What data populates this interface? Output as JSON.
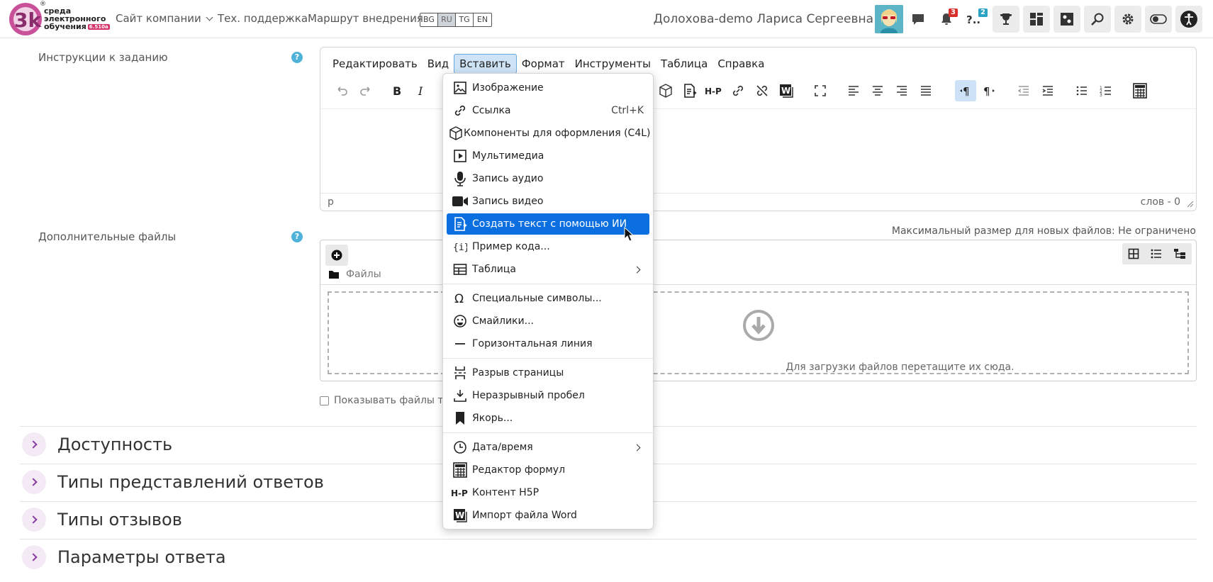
{
  "brand": {
    "lines": [
      "среда",
      "электронного",
      "обучения"
    ],
    "version": "6.510a",
    "reg_mark": "®"
  },
  "nav": {
    "company_site": "Сайт компании",
    "support": "Тех. поддержка",
    "roadmap": "Маршрут внедрения",
    "languages": [
      "BG",
      "RU",
      "TG",
      "EN"
    ],
    "active_language": "RU",
    "user_name": "Долохова-demo Лариса Сергеевна",
    "notifications_count": "3",
    "questions_count": "2"
  },
  "form": {
    "instructions_label": "Инструкции к заданию",
    "extra_files_label": "Дополнительные файлы",
    "help_glyph": "?",
    "max_size": "Максимальный размер для новых файлов: Не ограничено",
    "files_path": "Файлы",
    "dropzone_text": "Для загрузки файлов перетащите их сюда.",
    "show_files_label": "Показывать файлы тол"
  },
  "editor": {
    "menu": [
      "Редактировать",
      "Вид",
      "Вставить",
      "Формат",
      "Инструменты",
      "Таблица",
      "Справка"
    ],
    "active_menu": "Вставить",
    "status_path": "p",
    "word_count": "слов - 0"
  },
  "insert_menu": {
    "items": [
      {
        "label": "Изображение",
        "icon": "image-icon"
      },
      {
        "label": "Ссылка",
        "shortcut": "Ctrl+K",
        "icon": "link-icon"
      },
      {
        "label": "Компоненты для оформления (C4L)",
        "icon": "cube-icon"
      },
      {
        "label": "Мультимедиа",
        "icon": "media-icon"
      },
      {
        "label": "Запись аудио",
        "icon": "microphone-icon"
      },
      {
        "label": "Запись видео",
        "icon": "video-camera-icon"
      },
      {
        "label": "Создать текст с помощью ИИ",
        "icon": "ai-document-icon",
        "highlighted": true
      },
      {
        "label": "Пример кода...",
        "icon": "code-braces-icon"
      },
      {
        "label": "Таблица",
        "icon": "table-icon",
        "submenu": true
      },
      {
        "label": "Специальные символы...",
        "icon": "omega-icon"
      },
      {
        "label": "Смайлики...",
        "icon": "smiley-icon"
      },
      {
        "label": "Горизонтальная линия",
        "icon": "hr-line-icon"
      },
      {
        "label": "Разрыв страницы",
        "icon": "page-break-icon"
      },
      {
        "label": "Неразрывный пробел",
        "icon": "nbsp-icon"
      },
      {
        "label": "Якорь...",
        "icon": "bookmark-icon"
      },
      {
        "label": "Дата/время",
        "icon": "clock-icon",
        "submenu": true
      },
      {
        "label": "Редактор формул",
        "icon": "calculator-icon"
      },
      {
        "label": "Контент H5P",
        "icon": "h5p-icon"
      },
      {
        "label": "Импорт файла Word",
        "icon": "word-icon"
      }
    ]
  },
  "sections": [
    "Доступность",
    "Типы представлений ответов",
    "Типы отзывов",
    "Параметры ответа"
  ],
  "colors": {
    "highlight": "#0b6fe0",
    "accent_purple": "#8a3aa0",
    "help": "#4fb3d9",
    "badge_red": "#d9302c",
    "badge_teal": "#2aa2c5"
  }
}
